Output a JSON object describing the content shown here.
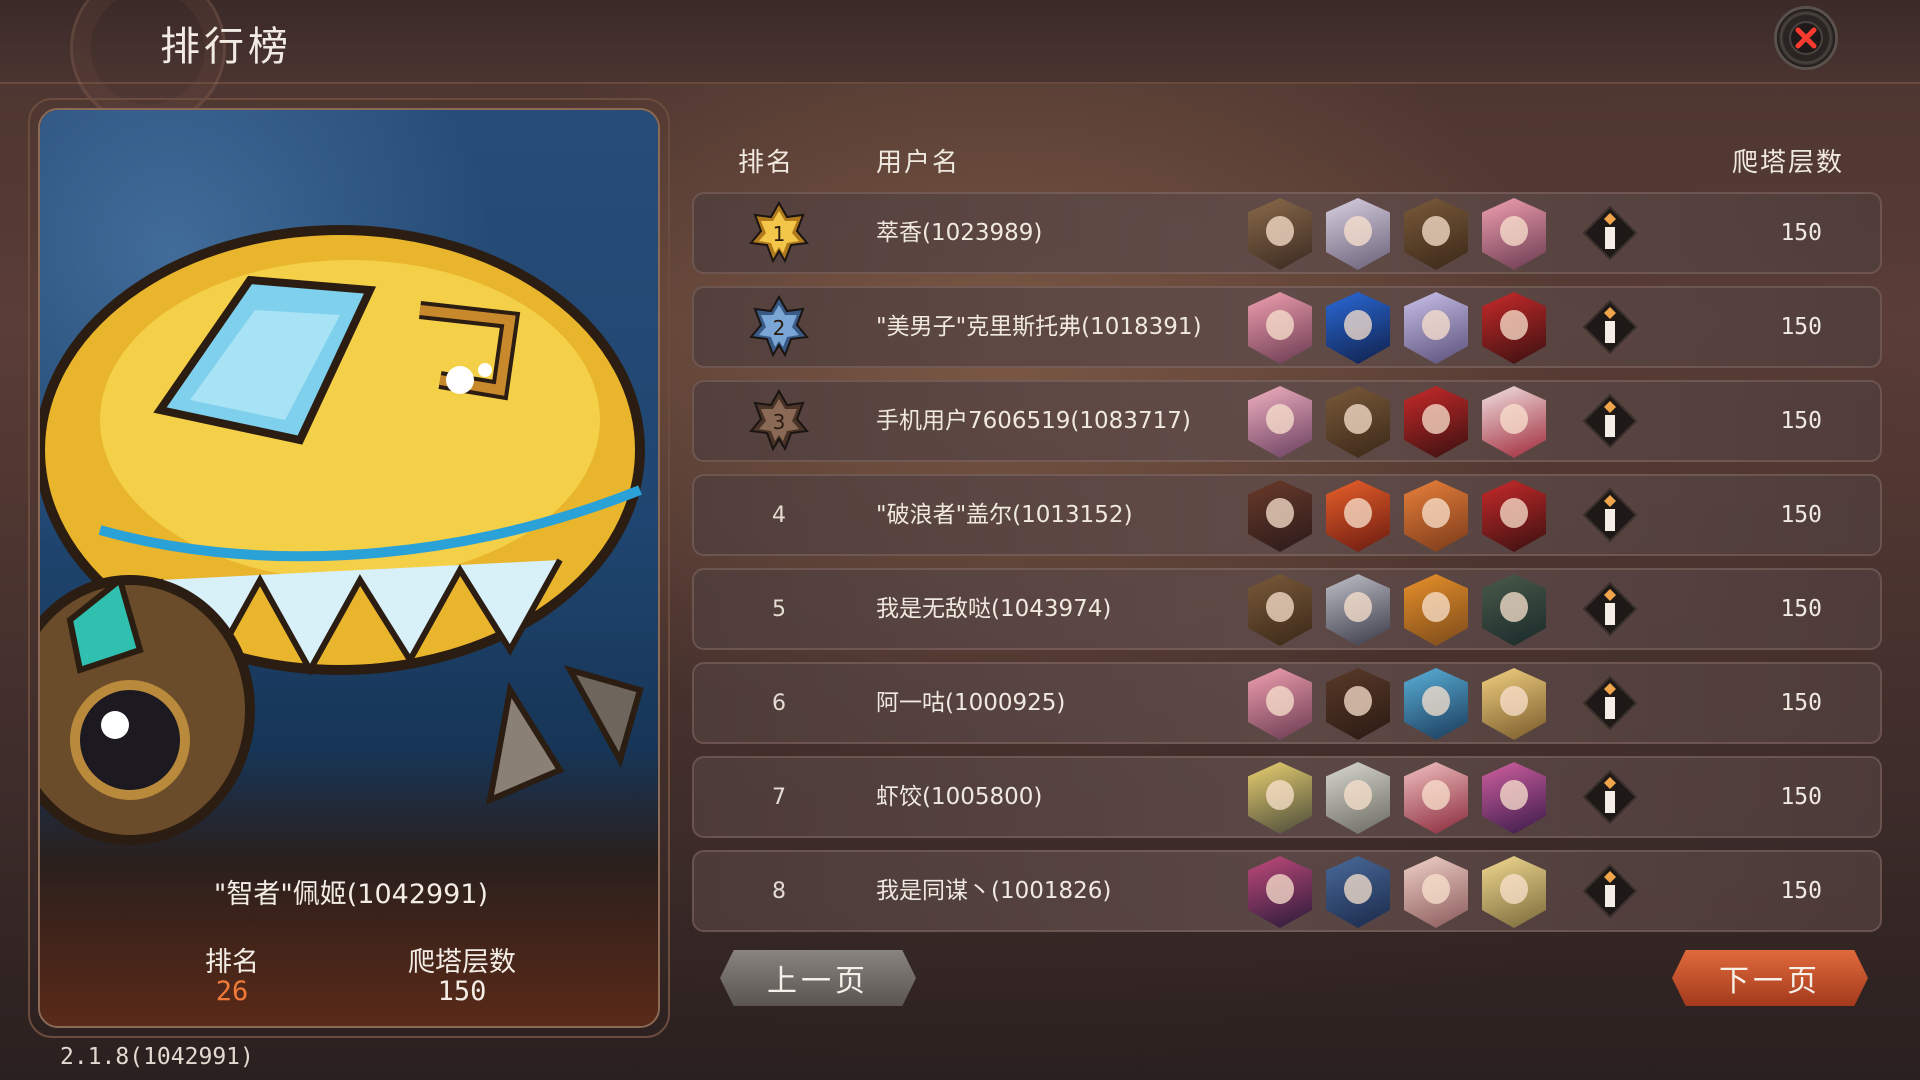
{
  "header": {
    "title": "排行榜"
  },
  "columns": {
    "rank": "排名",
    "username": "用户名",
    "floors": "爬塔层数"
  },
  "rows": [
    {
      "rank": "1",
      "name": "萃香(1023989)",
      "floors": "150",
      "medal": "gold"
    },
    {
      "rank": "2",
      "name": "\"美男子\"克里斯托弗(1018391)",
      "floors": "150",
      "medal": "silver"
    },
    {
      "rank": "3",
      "name": "手机用户7606519(1083717)",
      "floors": "150",
      "medal": "bronze"
    },
    {
      "rank": "4",
      "name": "\"破浪者\"盖尔(1013152)",
      "floors": "150"
    },
    {
      "rank": "5",
      "name": "我是无敌哒(1043974)",
      "floors": "150"
    },
    {
      "rank": "6",
      "name": "阿一咕(1000925)",
      "floors": "150"
    },
    {
      "rank": "7",
      "name": "虾饺(1005800)",
      "floors": "150"
    },
    {
      "rank": "8",
      "name": "我是同谋丶(1001826)",
      "floors": "150"
    }
  ],
  "my_card": {
    "name": "\"智者\"佩姬(1042991)",
    "rank_label": "排名",
    "rank_value": "26",
    "floors_label": "爬塔层数",
    "floors_value": "150"
  },
  "pagination": {
    "prev": "上一页",
    "next": "下一页"
  },
  "version": "2.1.8(1042991)",
  "colors": {
    "accent_orange": "#f07a3a",
    "gold": "#e8b53c",
    "silver_blue": "#5e86b8",
    "bronze": "#a07a5c"
  },
  "icons": {
    "close": "close-icon",
    "info": "info-icon",
    "medal": "star-medal-icon"
  }
}
